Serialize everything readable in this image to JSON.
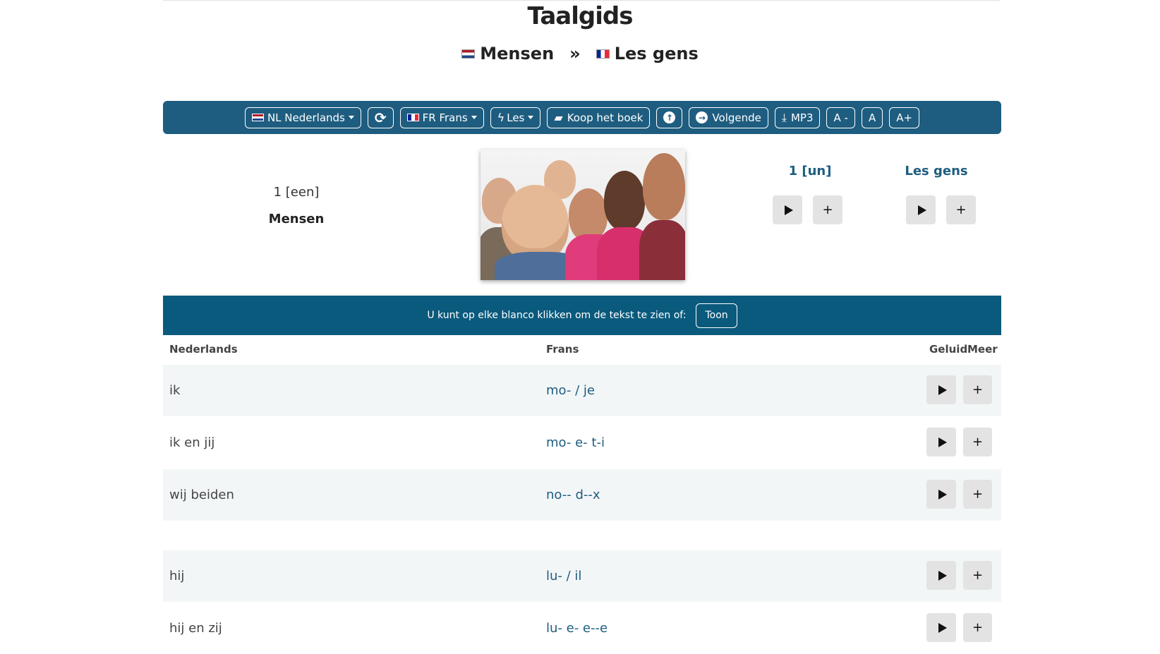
{
  "header": {
    "title": "Taalgids",
    "breadcrumb": {
      "source": "Mensen",
      "separator": "»",
      "target": "Les gens"
    }
  },
  "toolbar": {
    "source_lang": "NL Nederlands",
    "target_lang": "FR Frans",
    "lesson": "Les",
    "buy_book": "Koop het boek",
    "next": "Volgende",
    "mp3": "MP3",
    "font_smaller": "A -",
    "font_normal": "A",
    "font_larger": "A+"
  },
  "lesson": {
    "number_nl": "1 [een]",
    "name_nl": "Mensen",
    "number_fr": "1 [un]",
    "name_fr": "Les gens"
  },
  "banner": {
    "text": "U kunt op elke blanco klikken om de tekst te zien of:",
    "show_button": "Toon"
  },
  "table": {
    "headers": {
      "nl": "Nederlands",
      "fr": "Frans",
      "sound": "Geluid",
      "more": "Meer"
    },
    "rows": [
      {
        "nl": "ik",
        "fr": "mo- / je"
      },
      {
        "nl": "ik en jij",
        "fr": "mo- e- t-i"
      },
      {
        "nl": "wij beiden",
        "fr": "no-- d--x"
      },
      {
        "nl": "hij",
        "fr": "lu- / il"
      },
      {
        "nl": "hij en zij",
        "fr": "lu- e- e--e"
      }
    ]
  },
  "icons": {
    "refresh": "refresh-icon",
    "lightning": "lightning-icon",
    "book": "book-icon",
    "arrow_up": "arrow-up-icon",
    "arrow_right": "arrow-right-icon",
    "download": "download-icon",
    "play": "play-icon",
    "plus": "plus-icon"
  },
  "colors": {
    "toolbar": "#1e5d80",
    "banner": "#0a5a7d",
    "accent_text": "#1e5d80"
  }
}
